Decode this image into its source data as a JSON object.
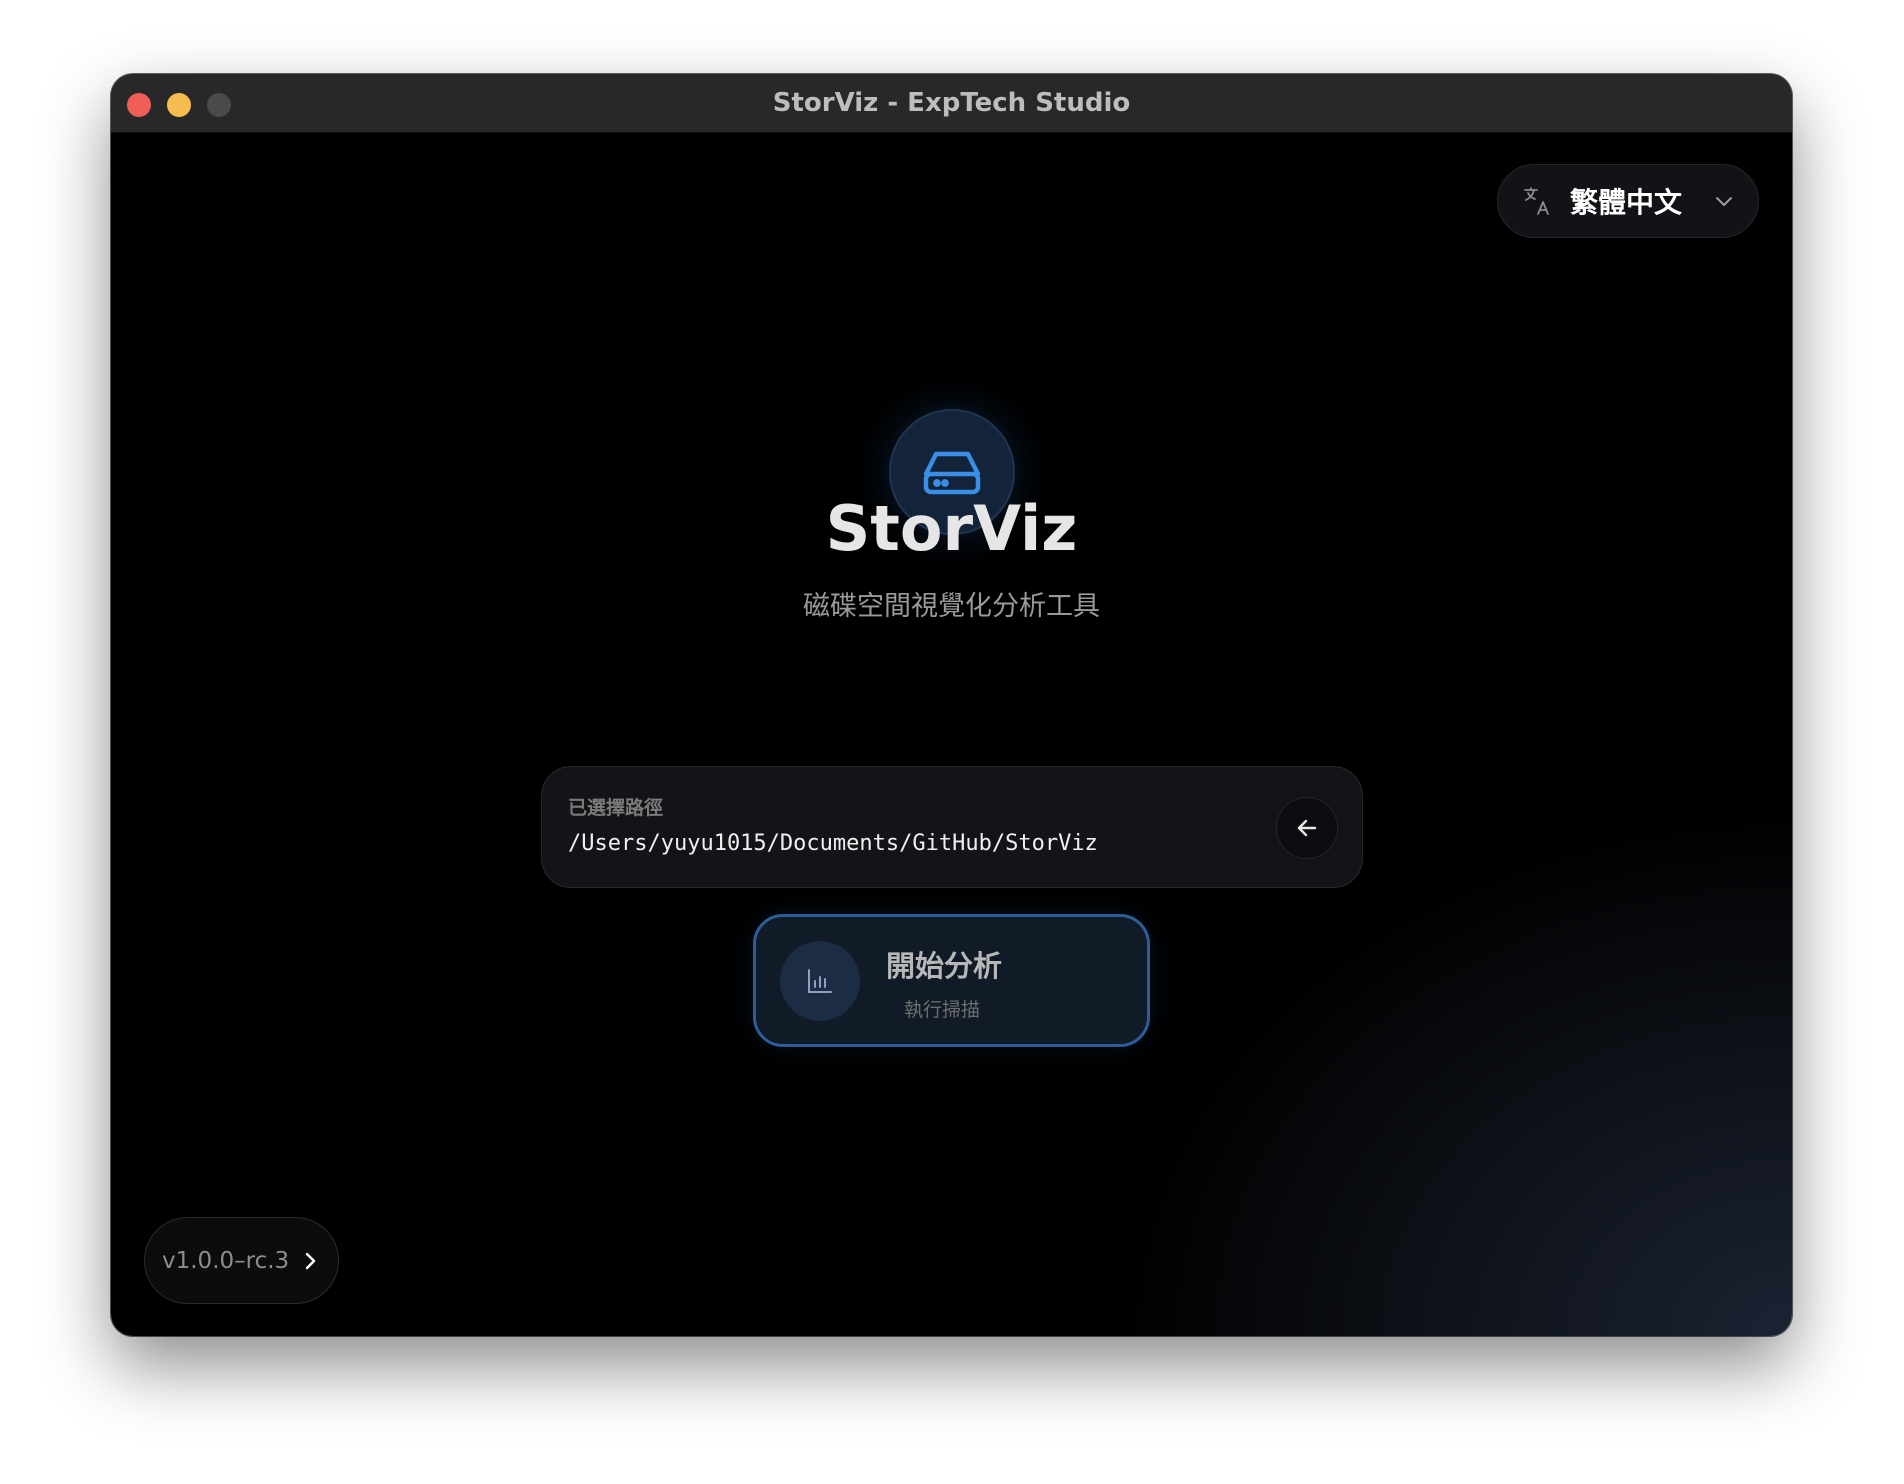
{
  "window": {
    "title": "StorViz - ExpTech Studio"
  },
  "language": {
    "selected": "繁體中文",
    "icon": "translate-icon"
  },
  "hero": {
    "icon": "hard-drive-icon",
    "app_name": "StorViz",
    "subtitle": "磁碟空間視覺化分析工具"
  },
  "path": {
    "label": "已選擇路徑",
    "value": "/Users/yuyu1015/Documents/GitHub/StorViz",
    "back_icon": "arrow-left-icon"
  },
  "start": {
    "title": "開始分析",
    "subtitle": "執行掃描",
    "icon": "bar-chart-icon"
  },
  "version": {
    "label": "v1.0.0–rc.3"
  },
  "colors": {
    "accent": "#3a8ee6",
    "button_border": "#2c5d9b",
    "traffic_close": "#ed5f57",
    "traffic_minimize": "#f5bd4f"
  }
}
